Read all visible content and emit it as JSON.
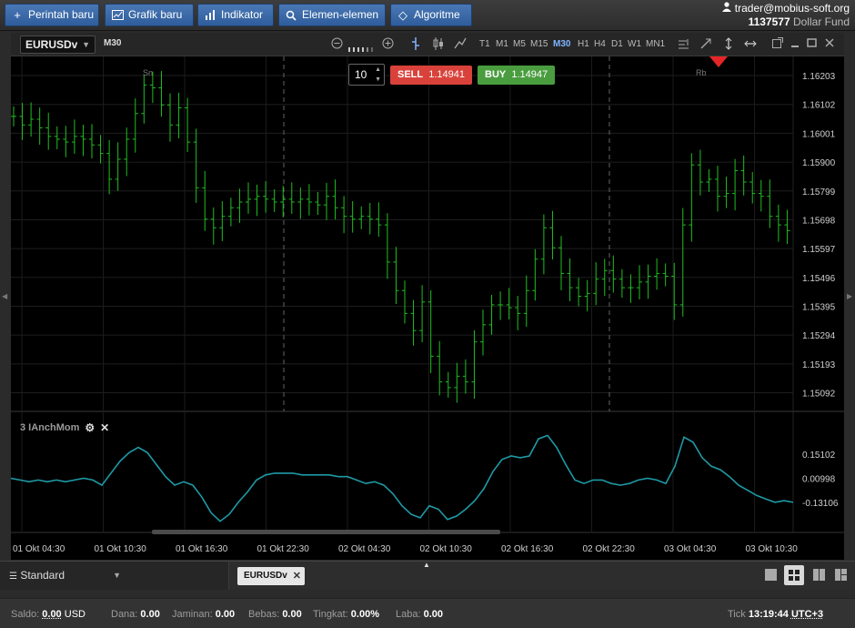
{
  "toolbar": {
    "new_order": "Perintah baru",
    "new_chart": "Grafik baru",
    "indicator": "Indikator",
    "elements": "Elemen-elemen",
    "algorithm": "Algoritme"
  },
  "account": {
    "email": "trader@mobius-soft.org",
    "number": "1137577",
    "fund": "Dollar Fund"
  },
  "chart_header": {
    "symbol": "EURUSDv",
    "timeframe_label": "M30",
    "timeframes": [
      "T1",
      "M1",
      "M5",
      "M15",
      "M30",
      "H1",
      "H4",
      "D1",
      "W1",
      "MN1"
    ],
    "active_timeframe": "M30"
  },
  "order_panel": {
    "quantity": "10",
    "sell_label": "SELL",
    "sell_price": "1.14941",
    "buy_label": "BUY",
    "buy_price": "1.14947"
  },
  "chart_data": {
    "type": "ohlc",
    "symbol": "EURUSDv",
    "timeframe": "M30",
    "price_axis_ticks": [
      "1.16203",
      "1.16102",
      "1.16001",
      "1.15900",
      "1.15799",
      "1.15698",
      "1.15597",
      "1.15496",
      "1.15395",
      "1.15294",
      "1.15193",
      "1.15092"
    ],
    "ylim": [
      1.1503,
      1.1627
    ],
    "time_axis_ticks": [
      "01 Okt 04:30",
      "01 Okt 10:30",
      "01 Okt 16:30",
      "01 Okt 22:30",
      "02 Okt 04:30",
      "02 Okt 10:30",
      "02 Okt 16:30",
      "02 Okt 22:30",
      "03 Okt 04:30",
      "03 Okt 10:30"
    ],
    "session_markers": [
      "Sn",
      "Rb"
    ],
    "close_series": [
      1.1606,
      1.1603,
      1.1605,
      1.1602,
      1.1599,
      1.1598,
      1.1597,
      1.1599,
      1.1598,
      1.1596,
      1.1593,
      1.1584,
      1.1591,
      1.1598,
      1.1607,
      1.1617,
      1.1616,
      1.161,
      1.1603,
      1.1609,
      1.1597,
      1.1581,
      1.157,
      1.1567,
      1.1571,
      1.1574,
      1.1576,
      1.1577,
      1.1578,
      1.1577,
      1.1576,
      1.1577,
      1.1576,
      1.1577,
      1.1576,
      1.1575,
      1.1578,
      1.1574,
      1.1571,
      1.157,
      1.1571,
      1.157,
      1.1568,
      1.1555,
      1.1545,
      1.1537,
      1.1531,
      1.1541,
      1.1522,
      1.1513,
      1.1511,
      1.1515,
      1.1513,
      1.1527,
      1.1533,
      1.154,
      1.154,
      1.1539,
      1.1537,
      1.1545,
      1.1556,
      1.1567,
      1.156,
      1.1551,
      1.1546,
      1.1543,
      1.1544,
      1.1549,
      1.1552,
      1.1549,
      1.1546,
      1.1546,
      1.1548,
      1.155,
      1.1551,
      1.155,
      1.154,
      1.1568,
      1.1589,
      1.1583,
      1.1584,
      1.1578,
      1.1579,
      1.1587,
      1.1583,
      1.1579,
      1.1578,
      1.1571,
      1.1568,
      1.1566
    ],
    "indicator": {
      "name": "3 IAnchMom",
      "axis_ticks": [
        "0.15102",
        "0.00998",
        "-0.13106"
      ],
      "ylim": [
        -0.3,
        0.4
      ],
      "values": [
        0.01,
        0.0,
        -0.01,
        0.0,
        -0.01,
        0.0,
        -0.01,
        0.0,
        0.01,
        0.0,
        -0.03,
        0.04,
        0.11,
        0.16,
        0.19,
        0.16,
        0.09,
        0.02,
        -0.03,
        -0.01,
        -0.03,
        -0.1,
        -0.19,
        -0.24,
        -0.2,
        -0.13,
        -0.07,
        0.0,
        0.03,
        0.04,
        0.04,
        0.04,
        0.03,
        0.03,
        0.03,
        0.03,
        0.02,
        0.02,
        0.0,
        -0.02,
        -0.01,
        -0.03,
        -0.08,
        -0.15,
        -0.2,
        -0.22,
        -0.15,
        -0.17,
        -0.23,
        -0.21,
        -0.17,
        -0.12,
        -0.05,
        0.05,
        0.12,
        0.14,
        0.13,
        0.14,
        0.24,
        0.26,
        0.19,
        0.09,
        0.0,
        -0.02,
        0.0,
        0.0,
        -0.02,
        -0.03,
        -0.02,
        0.0,
        0.01,
        0.0,
        -0.02,
        0.08,
        0.25,
        0.22,
        0.13,
        0.08,
        0.06,
        0.02,
        -0.03,
        -0.06,
        -0.09,
        -0.11,
        -0.13,
        -0.12,
        -0.13
      ]
    }
  },
  "tabs_bar": {
    "layout": "Standard",
    "chart_tab": "EURUSDv"
  },
  "status_bar": {
    "saldo_label": "Saldo:",
    "saldo_value": "0.00",
    "saldo_currency": "USD",
    "dana_label": "Dana:",
    "dana_value": "0.00",
    "jaminan_label": "Jaminan:",
    "jaminan_value": "0.00",
    "bebas_label": "Bebas:",
    "bebas_value": "0.00",
    "tingkat_label": "Tingkat:",
    "tingkat_value": "0.00%",
    "laba_label": "Laba:",
    "laba_value": "0.00",
    "tick_label": "Tick",
    "time": "13:19:44",
    "timezone": "UTC+3"
  }
}
